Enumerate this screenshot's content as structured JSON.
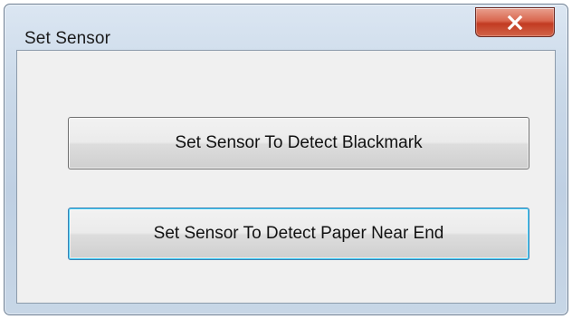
{
  "window": {
    "title": "Set Sensor",
    "close_icon": "close-icon"
  },
  "buttons": {
    "blackmark_label": "Set Sensor To Detect Blackmark",
    "paper_near_end_label": "Set Sensor To Detect Paper Near End"
  },
  "colors": {
    "close_button": "#c23b22",
    "client_background": "#f0f0f0",
    "focus_border": "#3c7fb1"
  }
}
